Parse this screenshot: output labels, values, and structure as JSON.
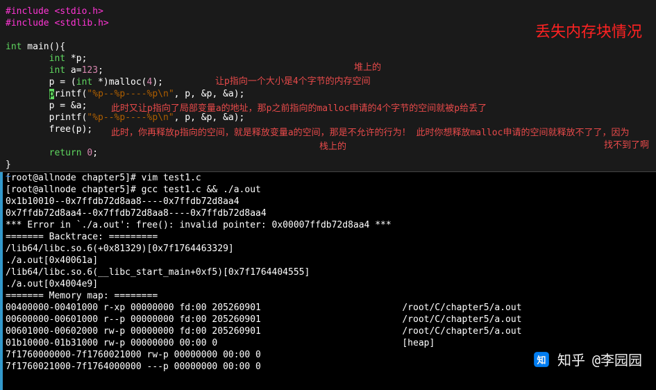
{
  "title": "丢失内存块情况",
  "code": {
    "l1_include1": "#include",
    "l1_path1": " <stdio.h>",
    "l2_include2": "#include",
    "l2_path2": " <stdlib.h>",
    "l4_int": "int",
    "l4_main": " main(){",
    "l5_int": "int",
    "l5_ptr": " *p;",
    "l6_int": "int",
    "l6_a": " a=",
    "l6_val": "123",
    "l6_semi": ";",
    "l7_p": "        p = (",
    "l7_cast": "int",
    "l7_p2": " *)malloc(",
    "l7_arg": "4",
    "l7_p3": ");",
    "l8_fn": "rintf(",
    "l8_cursor": "p",
    "l8_str": "\"%p--%p----%p\\n\"",
    "l8_args": ", p, &p, &a);",
    "l9": "        p = &a;",
    "l10_fn": "        printf(",
    "l10_str": "\"%p--%p----%p\\n\"",
    "l10_args": ", p, &p, &a);",
    "l11": "        free(p);",
    "l13_ret": "return",
    "l13_val": " 0",
    "l13_semi": ";",
    "l14": "}",
    "l15": "~"
  },
  "annotations": {
    "heap": "堆上的",
    "a1": "让p指向一个大小是4个字节的内存空间",
    "a2": "此时又让p指向了局部变量a的地址，那p之前指向的malloc申请的4个字节的空间就被p给丢了",
    "a3": "此时，你再释放p指向的空间，就是释放变量a的空间，那是不允许的行为！ 此时你想释放malloc申请的空间就释放不了了，因为",
    "stack": "栈上的",
    "a4": "找不到了啊"
  },
  "terminal": {
    "l1": "[root@allnode chapter5]# vim test1.c",
    "l2": "[root@allnode chapter5]# gcc test1.c && ./a.out",
    "l3": "0x1b10010--0x7ffdb72d8aa8----0x7ffdb72d8aa4",
    "l4": "0x7ffdb72d8aa4--0x7ffdb72d8aa8----0x7ffdb72d8aa4",
    "l5": "*** Error in `./a.out': free(): invalid pointer: 0x00007ffdb72d8aa4 ***",
    "l6": "======= Backtrace: =========",
    "l7": "/lib64/libc.so.6(+0x81329)[0x7f1764463329]",
    "l8": "./a.out[0x40061a]",
    "l9": "/lib64/libc.so.6(__libc_start_main+0xf5)[0x7f1764404555]",
    "l10": "./a.out[0x4004e9]",
    "l11": "======= Memory map: ========",
    "l12": "00400000-00401000 r-xp 00000000 fd:00 205260901                          /root/C/chapter5/a.out",
    "l13": "00600000-00601000 r--p 00000000 fd:00 205260901                          /root/C/chapter5/a.out",
    "l14": "00601000-00602000 rw-p 00000000 fd:00 205260901                          /root/C/chapter5/a.out",
    "l15": "01b10000-01b31000 rw-p 00000000 00:00 0                                  [heap]",
    "l16": "7f1760000000-7f1760021000 rw-p 00000000 00:00 0",
    "l17": "7f1760021000-7f1764000000 ---p 00000000 00:00 0"
  },
  "watermark": {
    "brand": "知乎",
    "author": "@李园园"
  }
}
